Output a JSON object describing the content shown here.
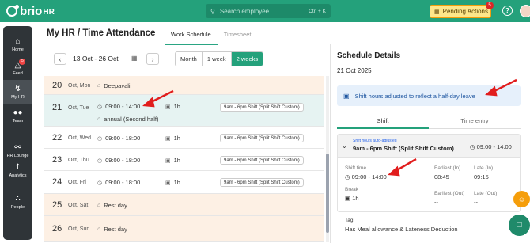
{
  "app": {
    "logo": "brio",
    "logo_suffix": "HR"
  },
  "topbar": {
    "search_placeholder": "Search employee",
    "search_shortcut": "Ctrl + K",
    "pending_label": "Pending Actions",
    "pending_count": "5"
  },
  "sidebar": {
    "items": [
      {
        "label": "Home",
        "icon": "home-icon",
        "glyph": "⌂"
      },
      {
        "label": "Feed",
        "icon": "megaphone-icon",
        "glyph": "📢",
        "badge": "5"
      },
      {
        "label": "My HR",
        "icon": "bolt-icon",
        "glyph": "ϟ"
      },
      {
        "label": "Team",
        "icon": "team-icon",
        "glyph": "👥"
      },
      {
        "label": "HR Lounge",
        "icon": "lounge-icon",
        "glyph": "☖"
      },
      {
        "label": "Analytics",
        "icon": "analytics-icon",
        "glyph": "〽"
      },
      {
        "label": "People",
        "icon": "people-icon",
        "glyph": "⁂"
      }
    ]
  },
  "header": {
    "breadcrumb": "My HR  /  Time Attendance",
    "tabs": [
      "Work Schedule",
      "Timesheet"
    ]
  },
  "toolbar": {
    "range": "13 Oct - 26 Oct",
    "views": [
      "Month",
      "1 week",
      "2 weeks"
    ],
    "active_view": "2 weeks"
  },
  "schedule": [
    {
      "day": "20",
      "label": "Oct, Mon",
      "note": "Deepavali",
      "type": "off"
    },
    {
      "day": "21",
      "label": "Oct, Tue",
      "time": "09:00 - 14:00",
      "hours": "1h",
      "shift": "9am - 6pm Shift (Split Shift Custom)",
      "sub": "annual (Second half)",
      "type": "selected"
    },
    {
      "day": "22",
      "label": "Oct, Wed",
      "time": "09:00 - 18:00",
      "hours": "1h",
      "shift": "9am - 6pm Shift (Split Shift Custom)",
      "type": "work"
    },
    {
      "day": "23",
      "label": "Oct, Thu",
      "time": "09:00 - 18:00",
      "hours": "1h",
      "shift": "9am - 6pm Shift (Split Shift Custom)",
      "type": "work"
    },
    {
      "day": "24",
      "label": "Oct, Fri",
      "time": "09:00 - 18:00",
      "hours": "1h",
      "shift": "9am - 6pm Shift (Split Shift Custom)",
      "type": "work"
    },
    {
      "day": "25",
      "label": "Oct, Sat",
      "note": "Rest day",
      "type": "off"
    },
    {
      "day": "26",
      "label": "Oct, Sun",
      "note": "Rest day",
      "type": "off"
    }
  ],
  "details": {
    "title": "Schedule Details",
    "date": "21 Oct 2025",
    "info": "Shift hours adjusted to reflect a half-day leave",
    "tabs": [
      "Shift",
      "Time entry"
    ],
    "card": {
      "auto_label": "Shift hours auto-adjusted",
      "name": "9am - 6pm Shift (Split Shift Custom)",
      "time": "09:00 - 14:00",
      "shift_time_label": "Shift time",
      "shift_time": "09:00 - 14:00",
      "earliest_in_label": "Earliest (In)",
      "earliest_in": "08:45",
      "late_in_label": "Late (In)",
      "late_in": "09:15",
      "break_label": "Break",
      "break": "1h",
      "earliest_out_label": "Earliest (Out)",
      "earliest_out": "--",
      "late_out_label": "Late (Out)",
      "late_out": "--"
    },
    "tag_label": "Tag",
    "tag_value": "Has Meal allowance & Lateness Deduction"
  },
  "colors": {
    "brand": "#24a17b",
    "annotation": "#e11d1d",
    "off_row": "#fdf0e4",
    "selected_row": "#e6f3f2"
  }
}
